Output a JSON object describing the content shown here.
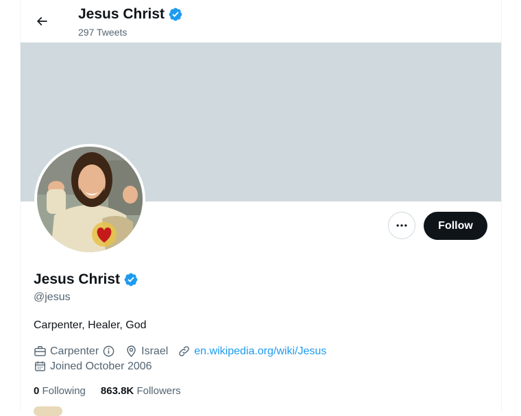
{
  "header": {
    "title": "Jesus Christ",
    "subtitle": "297 Tweets",
    "back_icon": "arrow-left-icon",
    "verified_icon": "verified-badge-icon"
  },
  "profile": {
    "name": "Jesus Christ",
    "handle": "@jesus",
    "bio": "Carpenter, Healer, God",
    "category": "Carpenter",
    "location": "Israel",
    "website": "en.wikipedia.org/wiki/Jesus",
    "joined": "Joined October 2006",
    "following_count": "0",
    "following_label": "Following",
    "followers_count": "863.8K",
    "followers_label": "Followers"
  },
  "actions": {
    "follow_label": "Follow",
    "more_icon": "more-dots-icon"
  },
  "colors": {
    "accent": "#1d9bf0",
    "banner": "#cfd9de",
    "follow_bg": "#0f1419",
    "text": "#0f1419",
    "muted": "#536471"
  }
}
